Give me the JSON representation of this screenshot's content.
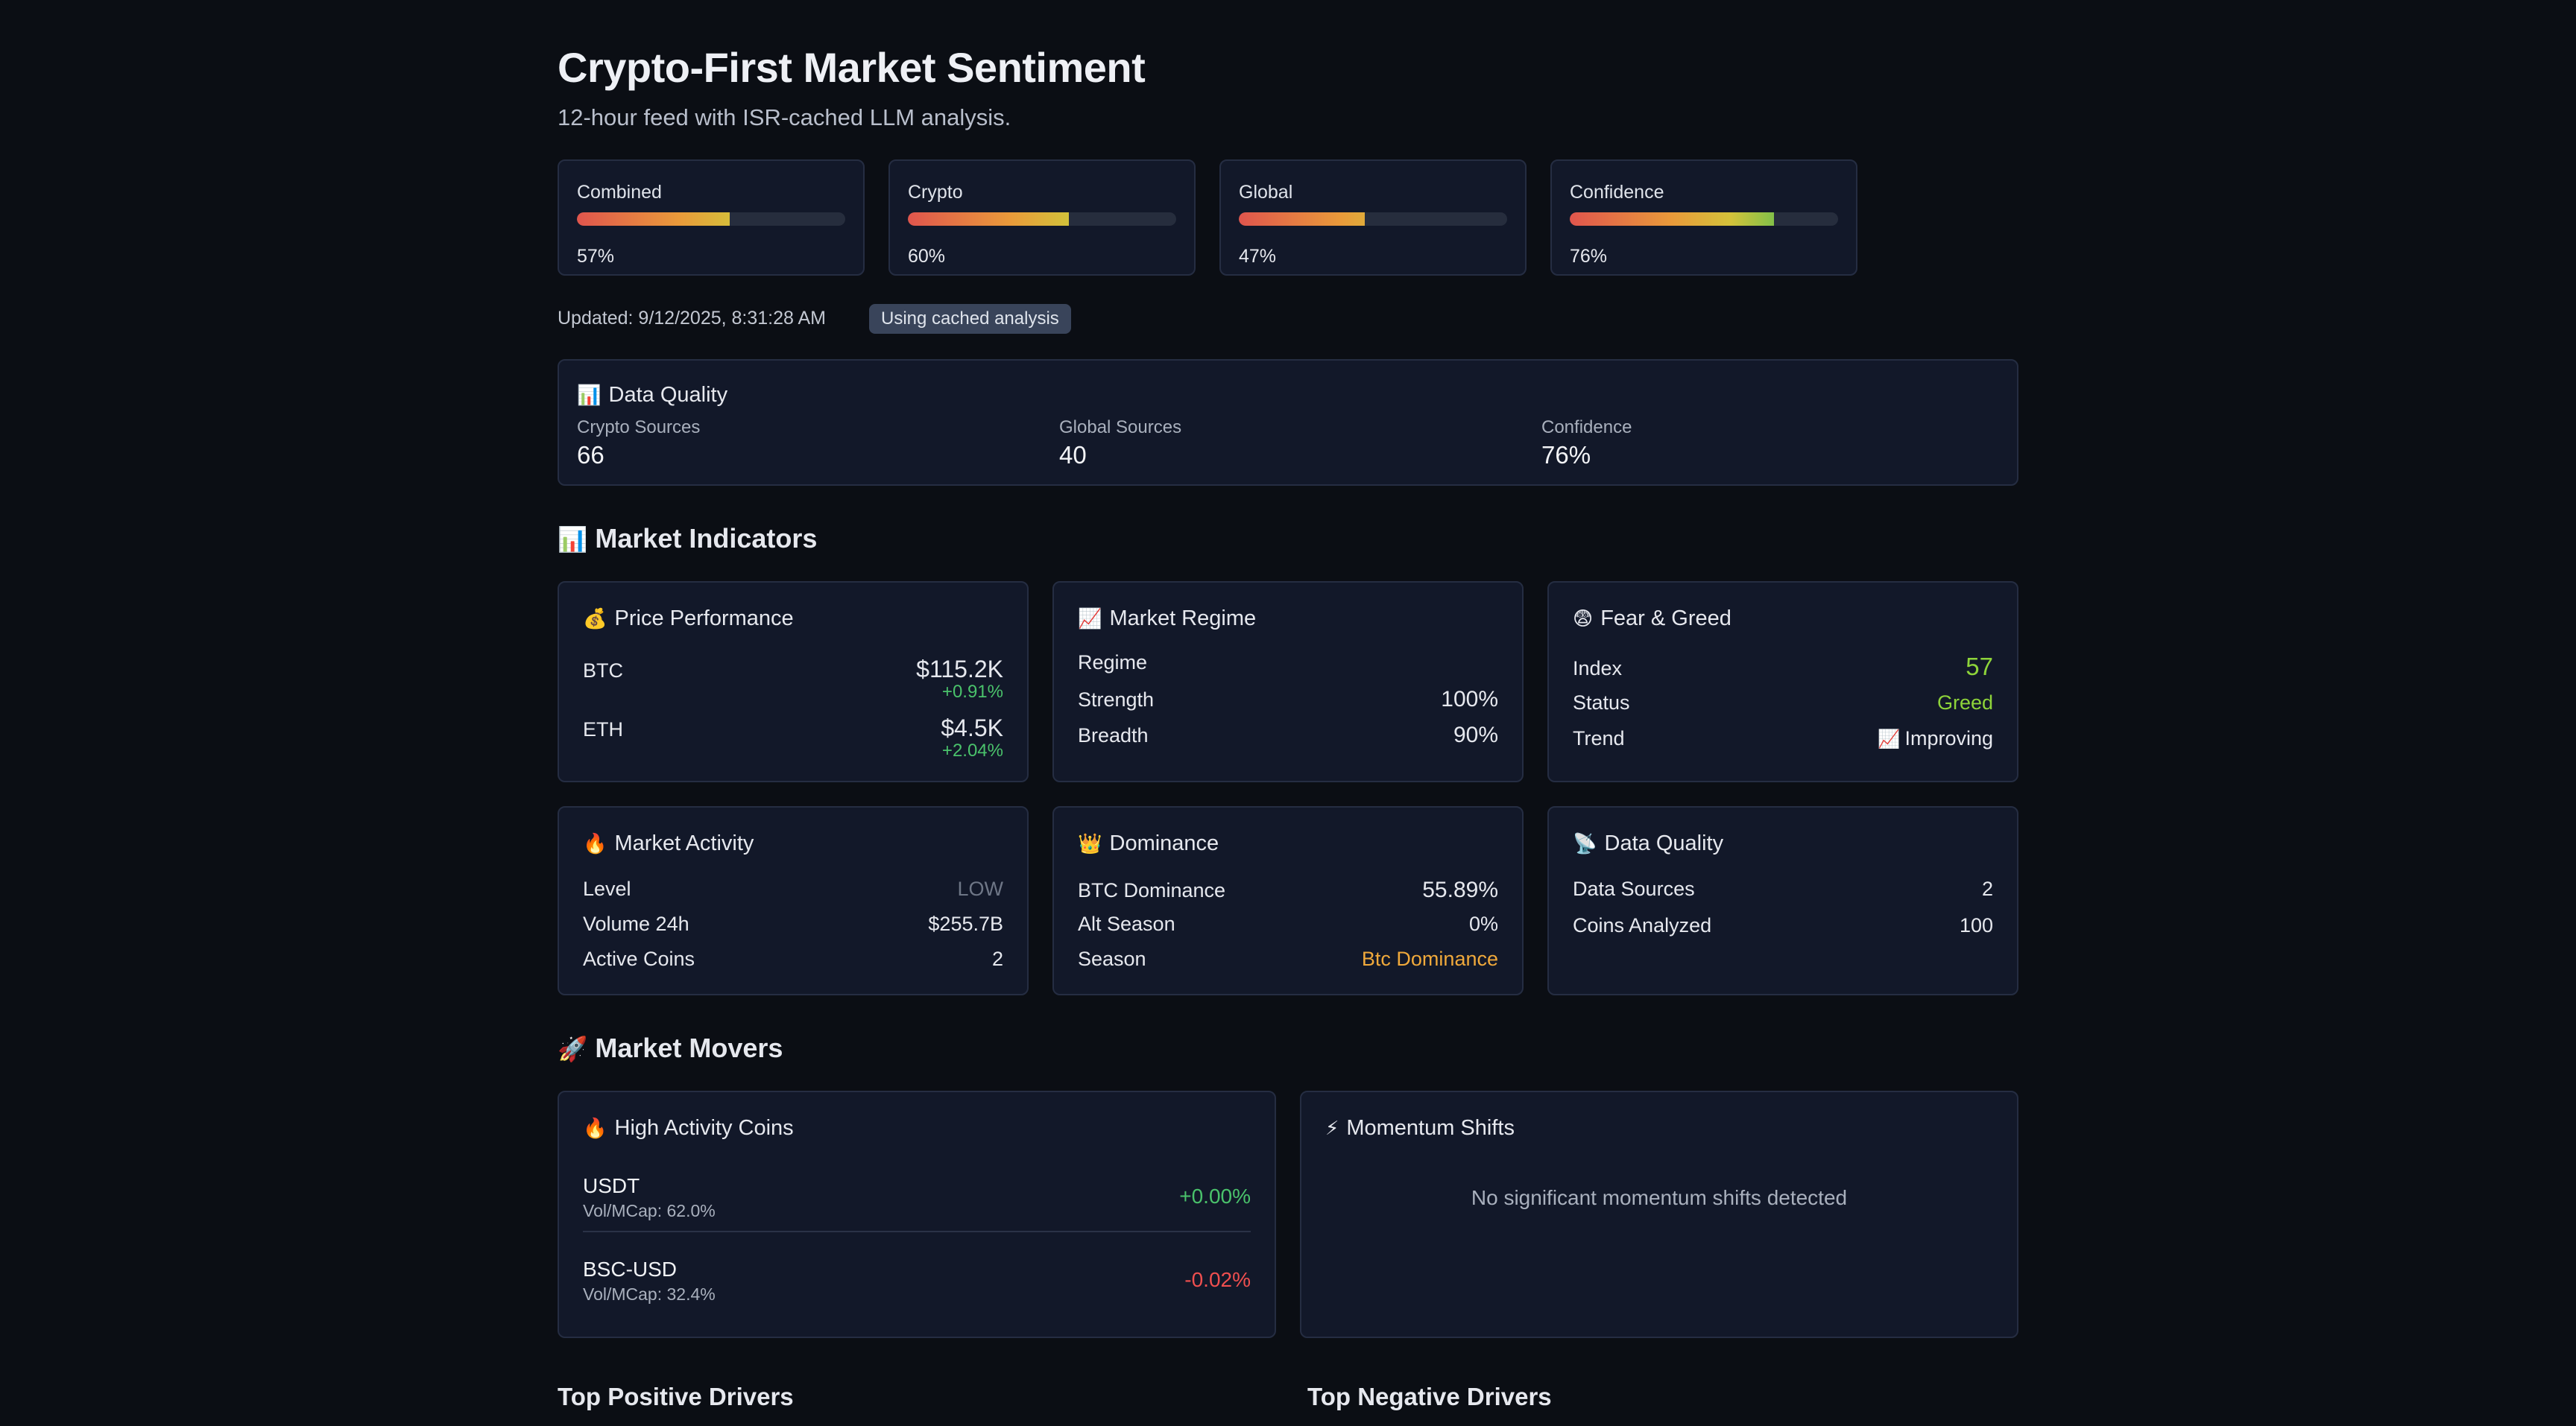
{
  "header": {
    "title": "Crypto-First Market Sentiment",
    "subtitle": "12-hour feed with ISR-cached LLM analysis."
  },
  "gauges": [
    {
      "label": "Combined",
      "value_text": "57%",
      "value": 0.57
    },
    {
      "label": "Crypto",
      "value_text": "60%",
      "value": 0.6
    },
    {
      "label": "Global",
      "value_text": "47%",
      "value": 0.47
    },
    {
      "label": "Confidence",
      "value_text": "76%",
      "value": 0.76
    }
  ],
  "status": {
    "updated": "Updated: 9/12/2025, 8:31:28 AM",
    "badge": "Using cached analysis"
  },
  "data_quality_summary": {
    "title": "Data Quality",
    "icon": "bar-chart-icon",
    "items": [
      {
        "label": "Crypto Sources",
        "value": "66"
      },
      {
        "label": "Global Sources",
        "value": "40"
      },
      {
        "label": "Confidence",
        "value": "76%"
      }
    ]
  },
  "market_indicators": {
    "heading": "Market Indicators",
    "heading_icon": "bar-chart-icon",
    "price_performance": {
      "title": "Price Performance",
      "icon": "money-bag-icon",
      "rows": [
        {
          "label": "BTC",
          "value": "$115.2K",
          "change": "+0.91%"
        },
        {
          "label": "ETH",
          "value": "$4.5K",
          "change": "+2.04%"
        }
      ]
    },
    "market_regime": {
      "title": "Market Regime",
      "icon": "chart-up-icon",
      "rows": [
        {
          "label": "Regime",
          "value": ""
        },
        {
          "label": "Strength",
          "value": "100%"
        },
        {
          "label": "Breadth",
          "value": "90%"
        }
      ]
    },
    "fear_greed": {
      "title": "Fear & Greed",
      "icon": "anxious-face-icon",
      "rows": [
        {
          "label": "Index",
          "value": "57"
        },
        {
          "label": "Status",
          "value": "Greed"
        },
        {
          "label": "Trend",
          "value": "Improving",
          "icon": "chart-up-icon"
        }
      ]
    },
    "market_activity": {
      "title": "Market Activity",
      "icon": "fire-icon",
      "rows": [
        {
          "label": "Level",
          "value": "LOW"
        },
        {
          "label": "Volume 24h",
          "value": "$255.7B"
        },
        {
          "label": "Active Coins",
          "value": "2"
        }
      ]
    },
    "dominance": {
      "title": "Dominance",
      "icon": "crown-icon",
      "rows": [
        {
          "label": "BTC Dominance",
          "value": "55.89%"
        },
        {
          "label": "Alt Season",
          "value": "0%"
        },
        {
          "label": "Season",
          "value": "Btc Dominance"
        }
      ]
    },
    "data_quality": {
      "title": "Data Quality",
      "icon": "satellite-dish-icon",
      "rows": [
        {
          "label": "Data Sources",
          "value": "2"
        },
        {
          "label": "Coins Analyzed",
          "value": "100"
        }
      ]
    }
  },
  "market_movers": {
    "heading": "Market Movers",
    "heading_icon": "rocket-icon",
    "high_activity": {
      "title": "High Activity Coins",
      "icon": "fire-icon",
      "coins": [
        {
          "name": "USDT",
          "meta": "Vol/MCap: 62.0%",
          "change": "+0.00%"
        },
        {
          "name": "BSC-USD",
          "meta": "Vol/MCap: 32.4%",
          "change": "-0.02%"
        }
      ]
    },
    "momentum": {
      "title": "Momentum Shifts",
      "icon": "lightning-icon",
      "empty_text": "No significant momentum shifts detected"
    }
  },
  "drivers": {
    "positive_heading": "Top Positive Drivers",
    "negative_heading": "Top Negative Drivers"
  },
  "colors": {
    "background": "#0b0e14",
    "card": "#121829",
    "positive": "#4ac26b",
    "negative": "#ef4f4f",
    "greed": "#8ed43a",
    "season": "#f0a93b"
  }
}
